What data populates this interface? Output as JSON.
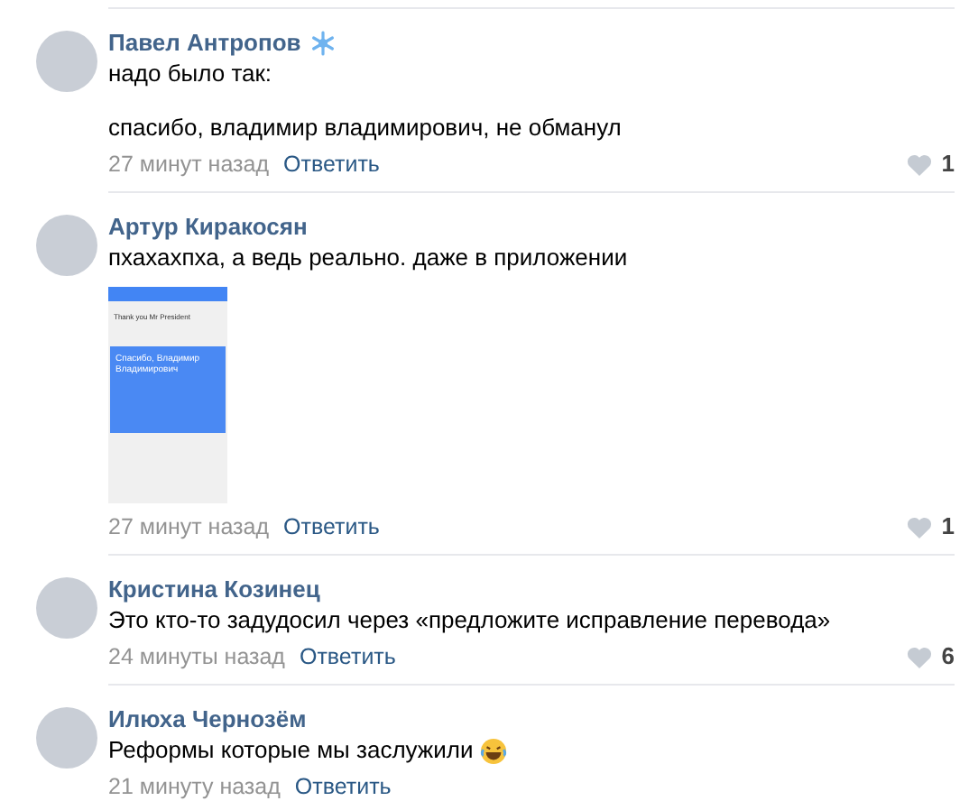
{
  "comments": [
    {
      "author": "Павел Антропов",
      "badge": true,
      "paragraphs": [
        "надо было так:",
        "спасибо, владимир владимирович, не обманул"
      ],
      "time": "27 минут назад",
      "reply": "Ответить",
      "likes": "1"
    },
    {
      "author": "Артур Киракосян",
      "badge": false,
      "paragraphs": [
        "пхахахпха, а ведь реально. даже в приложении"
      ],
      "attachment": {
        "source_text": "Thank you Mr President",
        "translation": "Спасибо, Владимир Владимирович"
      },
      "time": "27 минут назад",
      "reply": "Ответить",
      "likes": "1"
    },
    {
      "author": "Кристина Козинец",
      "badge": false,
      "paragraphs": [
        "Это кто-то задудосил через «предложите исправление перевода»"
      ],
      "time": "24 минуты назад",
      "reply": "Ответить",
      "likes": "6"
    },
    {
      "author": "Илюха Чернозём",
      "badge": false,
      "paragraphs": [
        "Реформы которые мы заслужили"
      ],
      "laughing_emoji": true,
      "time": "21 минуту назад",
      "reply": "Ответить"
    }
  ]
}
